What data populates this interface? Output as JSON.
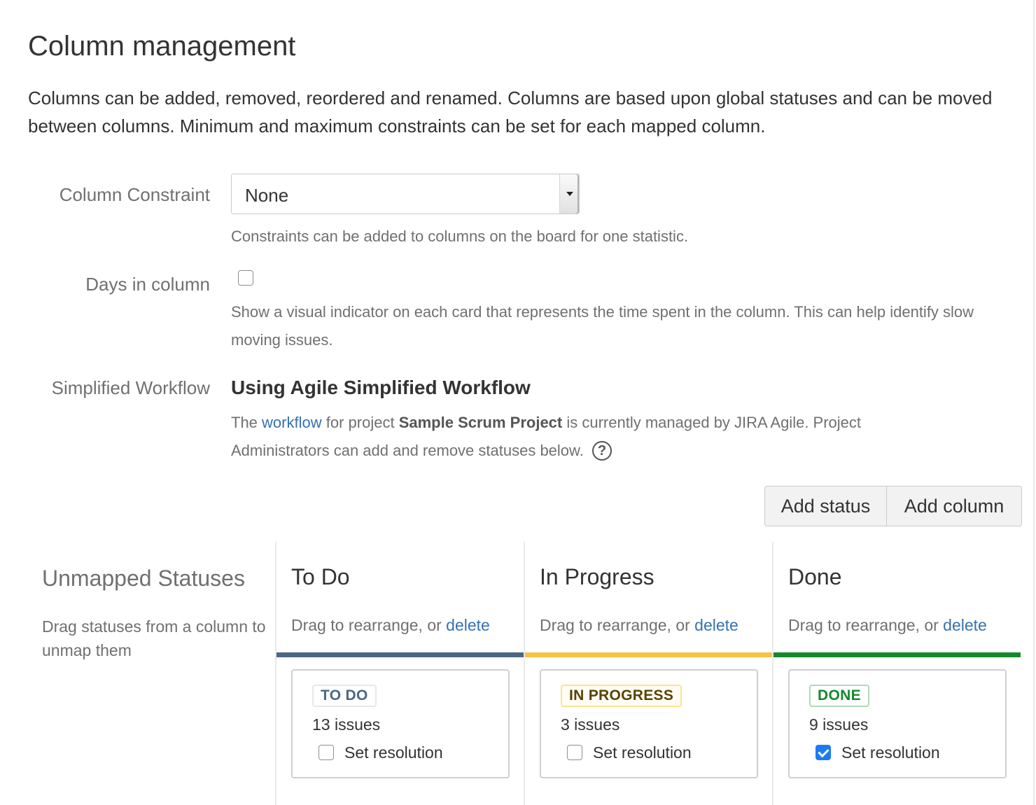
{
  "page": {
    "title": "Column management",
    "intro": "Columns can be added, removed, reordered and renamed. Columns are based upon global statuses and can be moved between columns. Minimum and maximum constraints can be set for each mapped column."
  },
  "constraint": {
    "label": "Column Constraint",
    "selected": "None",
    "help": "Constraints can be added to columns on the board for one statistic."
  },
  "days_in_column": {
    "label": "Days in column",
    "checked": false,
    "help": "Show a visual indicator on each card that represents the time spent in the column. This can help identify slow moving issues."
  },
  "workflow": {
    "label": "Simplified Workflow",
    "title": "Using Agile Simplified Workflow",
    "desc_prefix": "The",
    "link_text": "workflow",
    "desc_mid": "for project",
    "project_name": "Sample Scrum Project",
    "desc_suffix": "is currently managed by JIRA Agile. Project Administrators can add and remove statuses below.",
    "help_icon": "question-circle-icon",
    "help_glyph": "?"
  },
  "actions": {
    "add_status": "Add status",
    "add_column": "Add column"
  },
  "unmapped": {
    "title": "Unmapped Statuses",
    "desc": "Drag statuses from a column to unmap them"
  },
  "columns": [
    {
      "name": "To Do",
      "drag_text": "Drag to rearrange, or",
      "delete_text": "delete",
      "bar_color": "#4a6785",
      "status": {
        "lozenge": "TO DO",
        "lozenge_color": "#4a6785",
        "lozenge_border": "#e4e8ed",
        "lozenge_bg": "#ffffff",
        "issues": "13 issues",
        "resolution_label": "Set resolution",
        "resolution_checked": false
      }
    },
    {
      "name": "In Progress",
      "drag_text": "Drag to rearrange, or",
      "delete_text": "delete",
      "bar_color": "#f6c342",
      "status": {
        "lozenge": "IN PROGRESS",
        "lozenge_color": "#594300",
        "lozenge_border": "#ffe28c",
        "lozenge_bg": "#fffdf6",
        "issues": "3 issues",
        "resolution_label": "Set resolution",
        "resolution_checked": false
      }
    },
    {
      "name": "Done",
      "drag_text": "Drag to rearrange, or",
      "delete_text": "delete",
      "bar_color": "#14892c",
      "status": {
        "lozenge": "DONE",
        "lozenge_color": "#14892c",
        "lozenge_border": "#b2d8b9",
        "lozenge_bg": "#ffffff",
        "issues": "9 issues",
        "resolution_label": "Set resolution",
        "resolution_checked": true
      }
    }
  ],
  "colors": {
    "link": "#3572b0",
    "text": "#333333",
    "muted": "#707070",
    "checkbox_checked": "#1d7bf0"
  }
}
